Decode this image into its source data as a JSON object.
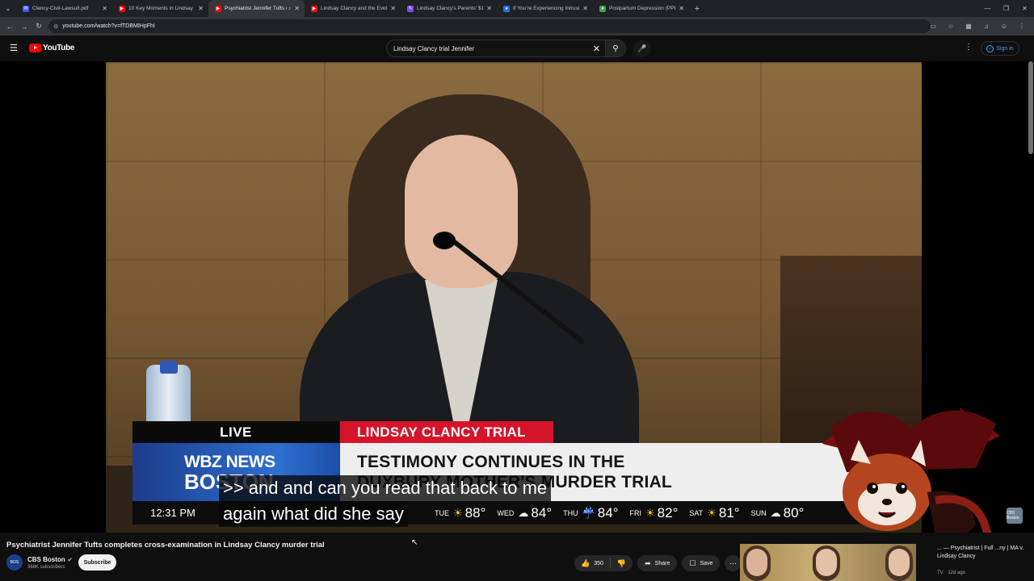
{
  "browser": {
    "tabs": [
      {
        "title": "Clancy-Civil-Lawsuit.pdf",
        "favicon_color": "#3d5afe",
        "favicon": "pdf-icon",
        "active": false
      },
      {
        "title": "10 Key Moments in Lindsay Cl...",
        "favicon_color": "#ff0000",
        "favicon": "youtube-icon",
        "active": false
      },
      {
        "title": "Psychiatrist Jennifer Tufts c...",
        "favicon_color": "#ff0000",
        "favicon": "youtube-icon",
        "active": true,
        "audio": true
      },
      {
        "title": "Lindsay Clancy and the Eviden...",
        "favicon_color": "#ff0000",
        "favicon": "youtube-icon",
        "active": false
      },
      {
        "title": "Lindsay Clancy's Parents' $1 Mi...",
        "favicon_color": "#7c4dff",
        "favicon": "doc-icon",
        "active": false
      },
      {
        "title": "If You're Experiencing Intrusive...",
        "favicon_color": "#1a73e8",
        "favicon": "web-icon",
        "active": false
      },
      {
        "title": "Postpartum Depression (PPD) ...",
        "favicon_color": "#34a853",
        "favicon": "web-icon",
        "active": false
      }
    ],
    "url": "youtube.com/watch?v=fTDBMIHpFhI"
  },
  "youtube": {
    "logo_text": "YouTube",
    "search_query": "Lindsay Clancy trial Jennifer",
    "sign_in_label": "Sign in"
  },
  "video": {
    "lower_third": {
      "live_label": "LIVE",
      "trial_label": "LINDSAY CLANCY TRIAL",
      "brand_line1": "WBZ NEWS",
      "brand_line2": "BOSTON",
      "headline_line1": "TESTIMONY CONTINUES IN THE",
      "headline_line2": "DUXBURY MOTHER'S MURDER TRIAL",
      "time": "12:31 PM",
      "weather": [
        {
          "day": "TUE",
          "icon": "sun-icon",
          "temp": "88°"
        },
        {
          "day": "WED",
          "icon": "cloud-icon",
          "temp": "84°"
        },
        {
          "day": "THU",
          "icon": "rain-icon",
          "temp": "84°"
        },
        {
          "day": "FRI",
          "icon": "sun-icon",
          "temp": "82°"
        },
        {
          "day": "SAT",
          "icon": "sun-icon",
          "temp": "81°"
        },
        {
          "day": "SUN",
          "icon": "cloud-icon",
          "temp": "80°"
        }
      ]
    },
    "captions": [
      ">> and and can you read that back to me",
      "again what did she say"
    ],
    "watermark": "CBS Boston"
  },
  "details": {
    "title": "Psychiatrist Jennifer Tufts completes cross-examination in Lindsay Clancy murder trial",
    "channel_name": "CBS Boston",
    "channel_initials": "BOS",
    "subscribers": "368K subscribers",
    "subscribe_label": "Subscribe",
    "likes": "350",
    "share_label": "Share",
    "save_label": "Save"
  },
  "recommended": {
    "title": "... — Psychiatrist | Full ...ny | MA v. Lindsay Clancy",
    "channel": "TV",
    "age": "12d ago"
  }
}
